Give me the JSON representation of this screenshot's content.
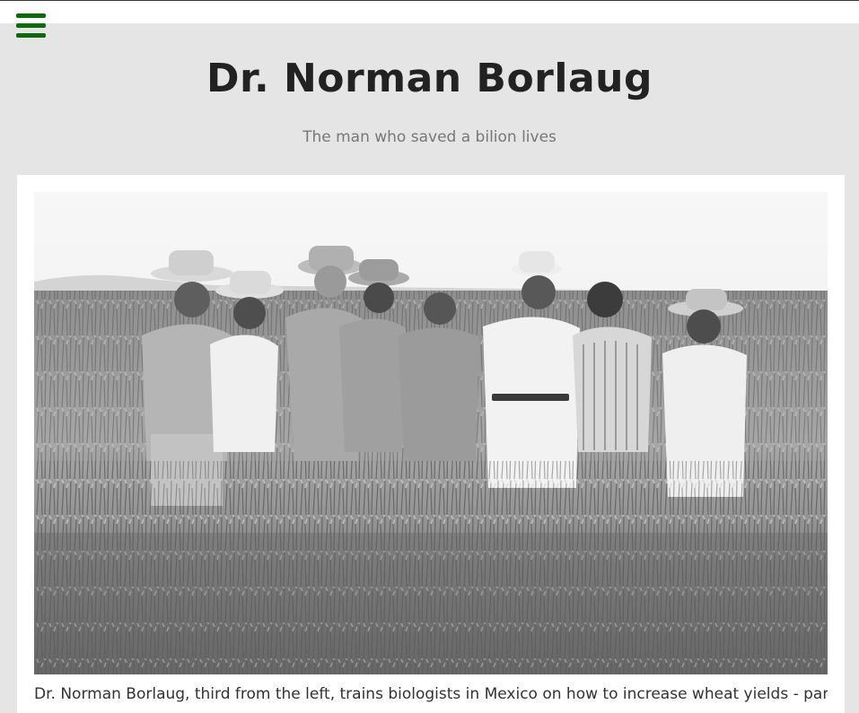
{
  "header": {
    "menu_icon": "hamburger-menu-icon",
    "title": "Dr. Norman Borlaug",
    "tagline": "The man who saved a bilion lives"
  },
  "article": {
    "photo": {
      "subject": "photograph-men-in-wheat-field",
      "style": "black-and-white"
    },
    "caption": "Dr. Norman Borlaug, third from the left, trains biologists in Mexico on how to increase wheat yields - part"
  },
  "colors": {
    "page_background": "#e6e5e5",
    "card_background": "#ffffff",
    "menu_icon": "#0a6b0a",
    "title_text": "#222222",
    "tagline_text": "#777777"
  }
}
